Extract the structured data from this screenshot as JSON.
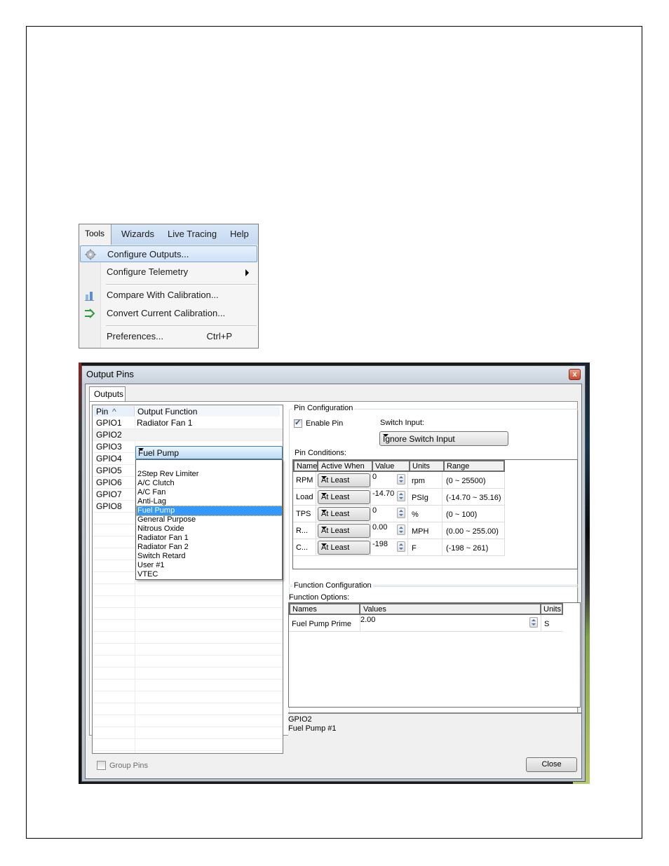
{
  "menu": {
    "bar_items": [
      "Tools",
      "Wizards",
      "Live Tracing",
      "Help"
    ],
    "items": [
      {
        "label": "Configure Outputs...",
        "icon": "gear-icon",
        "highlighted": true
      },
      {
        "label": "Configure Telemetry",
        "submenu": true
      },
      {
        "label": "Compare With Calibration...",
        "icon": "bar-chart-icon"
      },
      {
        "label": "Convert Current Calibration...",
        "icon": "convert-arrows-icon"
      },
      {
        "label": "Preferences...",
        "shortcut": "Ctrl+P"
      }
    ]
  },
  "dialog": {
    "title": "Output Pins",
    "close_glyph": "x",
    "tab": "Outputs",
    "pins": {
      "headers": {
        "pin": "Pin",
        "function": "Output Function"
      },
      "sort_glyph": "^",
      "rows": [
        {
          "pin": "GPIO1",
          "function": "Radiator Fan 1"
        },
        {
          "pin": "GPIO2",
          "function": "Fuel Pump"
        },
        {
          "pin": "GPIO3",
          "function": ""
        },
        {
          "pin": "GPIO4",
          "function": ""
        },
        {
          "pin": "GPIO5",
          "function": ""
        },
        {
          "pin": "GPIO6",
          "function": ""
        },
        {
          "pin": "GPIO7",
          "function": ""
        },
        {
          "pin": "GPIO8",
          "function": ""
        }
      ],
      "selected_index": 1,
      "function_options": [
        "",
        "2Step Rev Limiter",
        "A/C Clutch",
        "A/C Fan",
        "Anti-Lag",
        "Fuel Pump",
        "General Purpose",
        "Nitrous Oxide",
        "Radiator Fan 1",
        "Radiator Fan 2",
        "Switch Retard",
        "User #1",
        "VTEC"
      ],
      "selected_option": "Fuel Pump"
    },
    "pin_config": {
      "title": "Pin Configuration",
      "enable_label": "Enable Pin",
      "enabled": true,
      "switch_label": "Switch Input:",
      "switch_value": "Ignore Switch Input",
      "conditions_label": "Pin Conditions:",
      "headers": [
        "Name",
        "Active When",
        "Value",
        "Units",
        "Range"
      ],
      "rows": [
        {
          "name": "RPM",
          "active_when": "At Least",
          "value": "0",
          "units": "rpm",
          "range": "(0 ~ 25500)"
        },
        {
          "name": "Load",
          "active_when": "At Least",
          "value": "-14.70",
          "units": "PSIg",
          "range": "(-14.70 ~ 35.16)"
        },
        {
          "name": "TPS",
          "active_when": "At Least",
          "value": "0",
          "units": "%",
          "range": "(0 ~ 100)"
        },
        {
          "name": "R...",
          "active_when": "At Least",
          "value": "0.00",
          "units": "MPH",
          "range": "(0.00 ~ 255.00)"
        },
        {
          "name": "C...",
          "active_when": "At Least",
          "value": "-198",
          "units": "F",
          "range": "(-198 ~ 261)"
        }
      ]
    },
    "func_config": {
      "title": "Function Configuration",
      "options_label": "Function Options:",
      "headers": [
        "Names",
        "Values",
        "Units"
      ],
      "rows": [
        {
          "name": "Fuel Pump Prime",
          "value": "2.00",
          "units": "S"
        }
      ]
    },
    "info": {
      "line1": "GPIO2",
      "line2": "Fuel Pump #1"
    },
    "group_pins_label": "Group Pins",
    "group_pins_checked": false,
    "close_label": "Close"
  }
}
